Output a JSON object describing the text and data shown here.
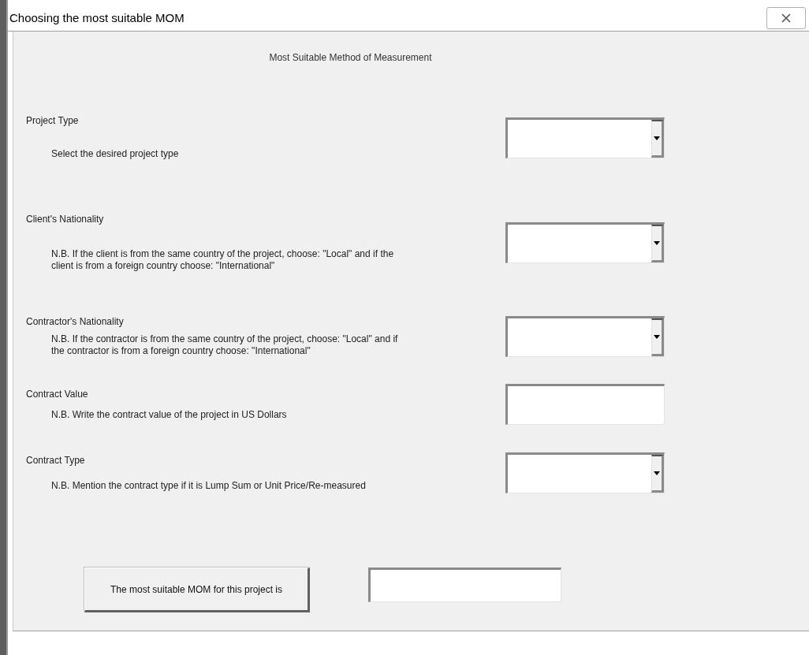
{
  "window": {
    "title": "Choosing the most suitable MOM"
  },
  "heading": "Most Suitable Method of Measurement",
  "fields": [
    {
      "label": "Project Type",
      "note_lines": [
        "Select the desired project type"
      ],
      "kind": "dropdown"
    },
    {
      "label": "Client's Nationality",
      "note_lines": [
        "N.B. If the client is from the same country of the project, choose: \"Local\" and if the",
        "client is from a foreign country choose: \"International\""
      ],
      "kind": "dropdown"
    },
    {
      "label": "Contractor's Nationality",
      "note_lines": [
        "N.B. If the contractor is from the same country of the project, choose: \"Local\" and if",
        "the contractor is from a foreign country choose: \"International\""
      ],
      "kind": "dropdown"
    },
    {
      "label": "Contract Value",
      "note_lines": [
        "N.B. Write the contract value of the project in US Dollars"
      ],
      "kind": "text"
    },
    {
      "label": "Contract Type",
      "note_lines": [
        "N.B. Mention the contract type if it is Lump Sum or Unit Price/Re-measured"
      ],
      "kind": "dropdown"
    }
  ],
  "result": {
    "button": "The most suitable MOM for this project is"
  }
}
